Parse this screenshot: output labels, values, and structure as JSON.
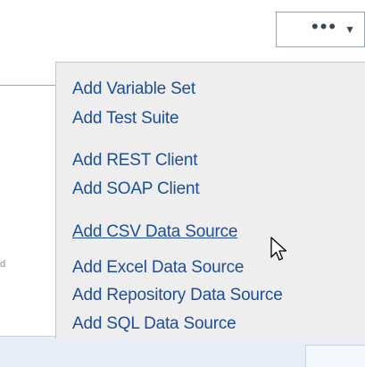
{
  "more_button": {
    "dots_icon": "more-dots",
    "caret_icon": "triangle-down",
    "dots_glyph": "•••",
    "caret_glyph": "▼"
  },
  "menu": {
    "items": [
      {
        "label": "Add Variable Set"
      },
      {
        "label": "Add Test Suite"
      },
      {
        "label": "Add REST Client"
      },
      {
        "label": "Add SOAP Client"
      },
      {
        "label": "Add CSV Data Source",
        "hovered": true
      },
      {
        "label": "Add Excel Data Source"
      },
      {
        "label": "Add Repository Data Source"
      },
      {
        "label": "Add SQL Data Source"
      }
    ]
  },
  "background": {
    "partial_char": "d"
  },
  "colors": {
    "menu_text": "#1f4e98",
    "menu_bg": "#eeeeee",
    "border": "#9aa6b2"
  }
}
